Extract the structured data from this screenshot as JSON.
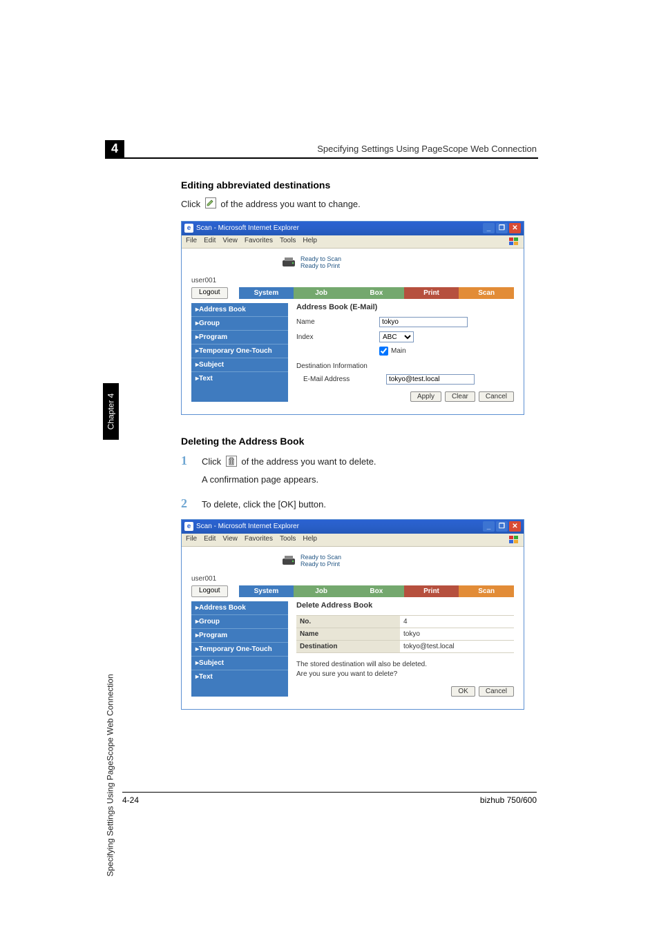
{
  "chapter": {
    "num": "4",
    "side_label": "Chapter 4",
    "running_title": "Specifying Settings Using PageScope Web Connection"
  },
  "header": "Specifying Settings Using PageScope Web Connection",
  "section1": {
    "title": "Editing abbreviated destinations",
    "line_before": "Click",
    "line_after": "of the address you want to change."
  },
  "ie": {
    "title": "Scan - Microsoft Internet Explorer",
    "menus": [
      "File",
      "Edit",
      "View",
      "Favorites",
      "Tools",
      "Help"
    ],
    "status": {
      "scan": "Ready to Scan",
      "print": "Ready to Print"
    },
    "user": "user001",
    "logout": "Logout",
    "tabs": {
      "system": "System",
      "job": "Job",
      "box": "Box",
      "print": "Print",
      "scan": "Scan"
    },
    "sidebar": {
      "address": "▸Address Book",
      "group": "▸Group",
      "program": "▸Program",
      "temp": "▸Temporary One-Touch",
      "subject": "▸Subject",
      "text": "▸Text"
    }
  },
  "edit_panel": {
    "heading": "Address Book (E-Mail)",
    "rows": {
      "name": "Name",
      "index": "Index"
    },
    "name_value": "tokyo",
    "index_value": "ABC",
    "main_checkbox": "Main",
    "dest_heading": "Destination Information",
    "email_label": "E-Mail Address",
    "email_value": "tokyo@test.local",
    "buttons": {
      "apply": "Apply",
      "clear": "Clear",
      "cancel": "Cancel"
    }
  },
  "section2": {
    "title": "Deleting the Address Book",
    "steps": {
      "s1": "1",
      "s1_before": "Click",
      "s1_after": "of the address you want to delete.",
      "s1_sub": "A confirmation page appears.",
      "s2": "2",
      "s2_text": "To delete, click the [OK] button."
    }
  },
  "delete_panel": {
    "heading": "Delete Address Book",
    "rows": {
      "no": "No.",
      "no_val": "4",
      "name": "Name",
      "name_val": "tokyo",
      "dest": "Destination",
      "dest_val": "tokyo@test.local"
    },
    "confirm1": "The stored destination will also be deleted.",
    "confirm2": "Are you sure you want to delete?",
    "buttons": {
      "ok": "OK",
      "cancel": "Cancel"
    }
  },
  "footer": {
    "left": "4-24",
    "right": "bizhub 750/600"
  }
}
